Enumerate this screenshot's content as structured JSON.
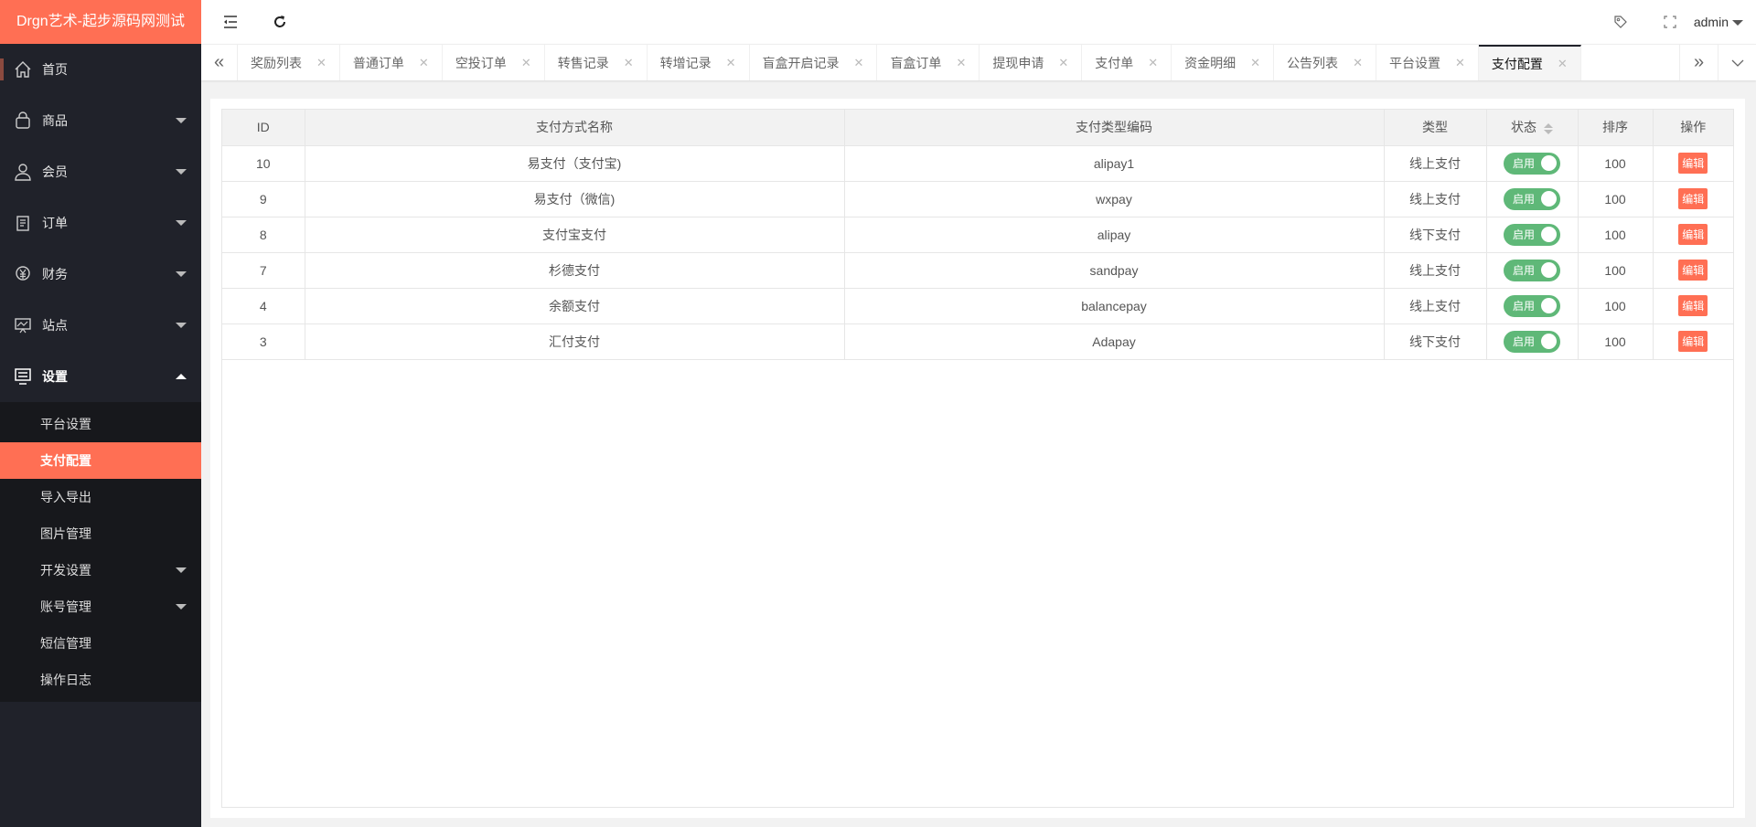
{
  "logo": "Drgn艺术-起步源码网测试",
  "header": {
    "user": "admin"
  },
  "sidebar": {
    "items": [
      {
        "label": "首页",
        "icon": "home-icon"
      },
      {
        "label": "商品",
        "icon": "bag-icon"
      },
      {
        "label": "会员",
        "icon": "user-icon"
      },
      {
        "label": "订单",
        "icon": "clipboard-icon"
      },
      {
        "label": "财务",
        "icon": "money-icon"
      },
      {
        "label": "站点",
        "icon": "chart-screen-icon"
      },
      {
        "label": "设置",
        "icon": "settings-monitor-icon"
      }
    ],
    "sub": [
      "平台设置",
      "支付配置",
      "导入导出",
      "图片管理",
      "开发设置",
      "账号管理",
      "短信管理",
      "操作日志"
    ]
  },
  "tabs": [
    "奖励列表",
    "普通订单",
    "空投订单",
    "转售记录",
    "转增记录",
    "盲盒开启记录",
    "盲盒订单",
    "提现申请",
    "支付单",
    "资金明细",
    "公告列表",
    "平台设置",
    "支付配置"
  ],
  "table": {
    "headers": [
      "ID",
      "支付方式名称",
      "支付类型编码",
      "类型",
      "状态",
      "排序",
      "操作"
    ],
    "rows": [
      {
        "id": "10",
        "name": "易支付（支付宝)",
        "code": "alipay1",
        "type": "线上支付",
        "status": "启用",
        "sort": "100",
        "action": "编辑"
      },
      {
        "id": "9",
        "name": "易支付（微信)",
        "code": "wxpay",
        "type": "线上支付",
        "status": "启用",
        "sort": "100",
        "action": "编辑"
      },
      {
        "id": "8",
        "name": "支付宝支付",
        "code": "alipay",
        "type": "线下支付",
        "status": "启用",
        "sort": "100",
        "action": "编辑"
      },
      {
        "id": "7",
        "name": "杉德支付",
        "code": "sandpay",
        "type": "线上支付",
        "status": "启用",
        "sort": "100",
        "action": "编辑"
      },
      {
        "id": "4",
        "name": "余额支付",
        "code": "balancepay",
        "type": "线上支付",
        "status": "启用",
        "sort": "100",
        "action": "编辑"
      },
      {
        "id": "3",
        "name": "汇付支付",
        "code": "Adapay",
        "type": "线下支付",
        "status": "启用",
        "sort": "100",
        "action": "编辑"
      }
    ]
  }
}
